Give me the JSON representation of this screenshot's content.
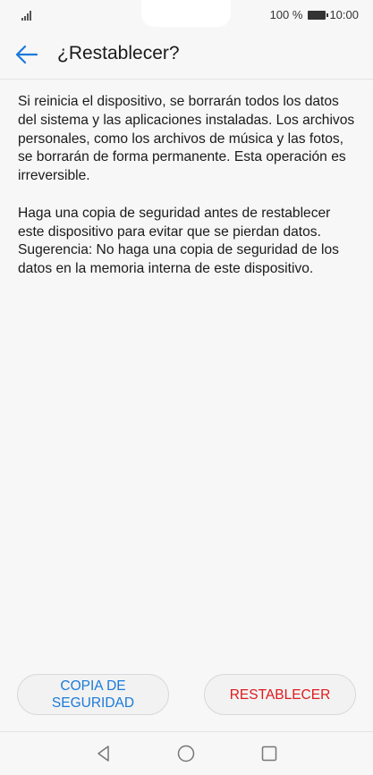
{
  "status_bar": {
    "battery_percent": "100 %",
    "time": "10:00",
    "signal_icon": "signal-bars-icon",
    "battery_icon": "battery-icon"
  },
  "header": {
    "title": "¿Restablecer?",
    "back_icon": "back-arrow-icon"
  },
  "body": {
    "paragraph_1": "Si reinicia el dispositivo, se borrarán todos los datos del sistema y las aplicaciones instaladas. Los archivos personales, como los archivos de música y las fotos, se borrarán de forma permanente. Esta operación es irreversible.",
    "paragraph_2": "Haga una copia de seguridad antes de restablecer este dispositivo para evitar que se pierdan datos. Sugerencia: No haga una copia de seguridad de los datos en la memoria interna de este dispositivo."
  },
  "buttons": {
    "backup_label_line1": "COPIA DE",
    "backup_label_line2": "SEGURIDAD",
    "reset_label": "RESTABLECER"
  },
  "colors": {
    "accent_blue": "#1a7ad9",
    "danger_red": "#e0191c",
    "background": "#f7f7f7"
  },
  "nav_bar": {
    "back_icon": "triangle-back-icon",
    "home_icon": "circle-home-icon",
    "recents_icon": "square-recents-icon"
  }
}
